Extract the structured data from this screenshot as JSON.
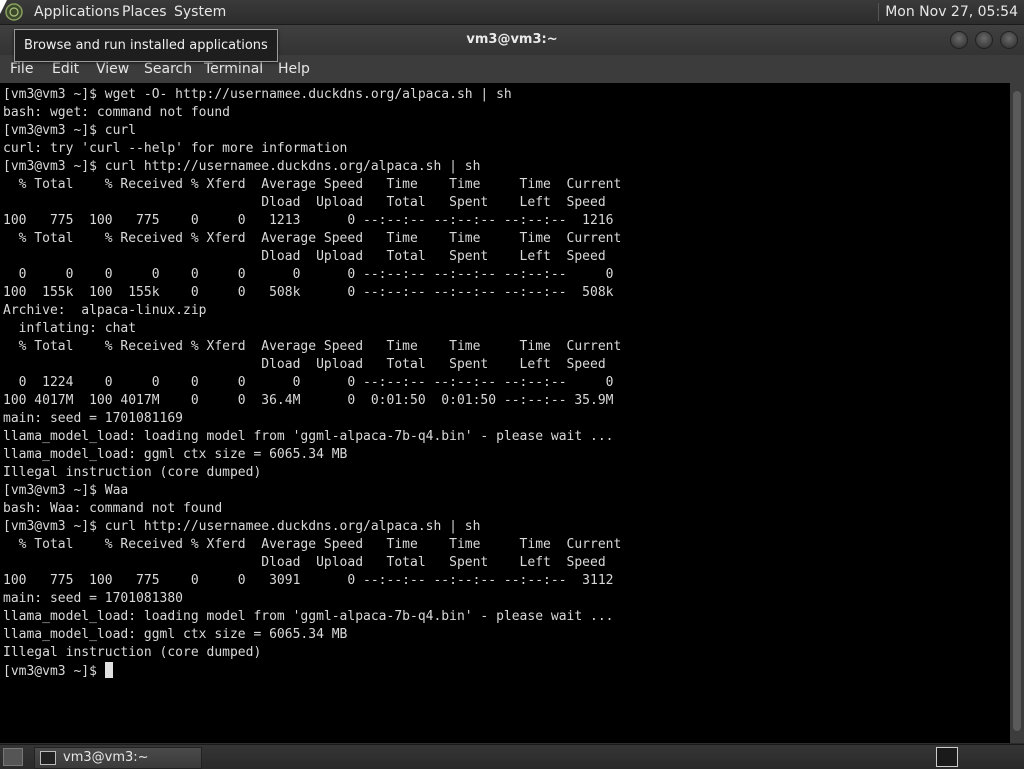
{
  "top_panel": {
    "menus": [
      "Applications",
      "Places",
      "System"
    ],
    "clock": "Mon Nov 27, 05:54"
  },
  "tooltip": {
    "text": "Browse and run installed applications"
  },
  "window": {
    "title": "vm3@vm3:~",
    "menubar": [
      "File",
      "Edit",
      "View",
      "Search",
      "Terminal",
      "Help"
    ]
  },
  "terminal": {
    "lines": [
      "[vm3@vm3 ~]$ wget -O- http://usernamee.duckdns.org/alpaca.sh | sh",
      "bash: wget: command not found",
      "[vm3@vm3 ~]$ curl",
      "curl: try 'curl --help' for more information",
      "[vm3@vm3 ~]$ curl http://usernamee.duckdns.org/alpaca.sh | sh",
      "  % Total    % Received % Xferd  Average Speed   Time    Time     Time  Current",
      "                                 Dload  Upload   Total   Spent    Left  Speed",
      "100   775  100   775    0     0   1213      0 --:--:-- --:--:-- --:--:--  1216",
      "  % Total    % Received % Xferd  Average Speed   Time    Time     Time  Current",
      "                                 Dload  Upload   Total   Spent    Left  Speed",
      "  0     0    0     0    0     0      0      0 --:--:-- --:--:-- --:--:--     0",
      "100  155k  100  155k    0     0   508k      0 --:--:-- --:--:-- --:--:--  508k",
      "Archive:  alpaca-linux.zip",
      "  inflating: chat",
      "  % Total    % Received % Xferd  Average Speed   Time    Time     Time  Current",
      "                                 Dload  Upload   Total   Spent    Left  Speed",
      "  0  1224    0     0    0     0      0      0 --:--:-- --:--:-- --:--:--     0",
      "100 4017M  100 4017M    0     0  36.4M      0  0:01:50  0:01:50 --:--:-- 35.9M",
      "main: seed = 1701081169",
      "llama_model_load: loading model from 'ggml-alpaca-7b-q4.bin' - please wait ...",
      "llama_model_load: ggml ctx size = 6065.34 MB",
      "Illegal instruction (core dumped)",
      "[vm3@vm3 ~]$ Waa",
      "bash: Waa: command not found",
      "[vm3@vm3 ~]$ curl http://usernamee.duckdns.org/alpaca.sh | sh",
      "  % Total    % Received % Xferd  Average Speed   Time    Time     Time  Current",
      "                                 Dload  Upload   Total   Spent    Left  Speed",
      "100   775  100   775    0     0   3091      0 --:--:-- --:--:-- --:--:--  3112",
      "main: seed = 1701081380",
      "llama_model_load: loading model from 'ggml-alpaca-7b-q4.bin' - please wait ...",
      "llama_model_load: ggml ctx size = 6065.34 MB",
      "Illegal instruction (core dumped)"
    ],
    "prompt": "[vm3@vm3 ~]$ "
  },
  "taskbar": {
    "task_label": "vm3@vm3:~"
  }
}
